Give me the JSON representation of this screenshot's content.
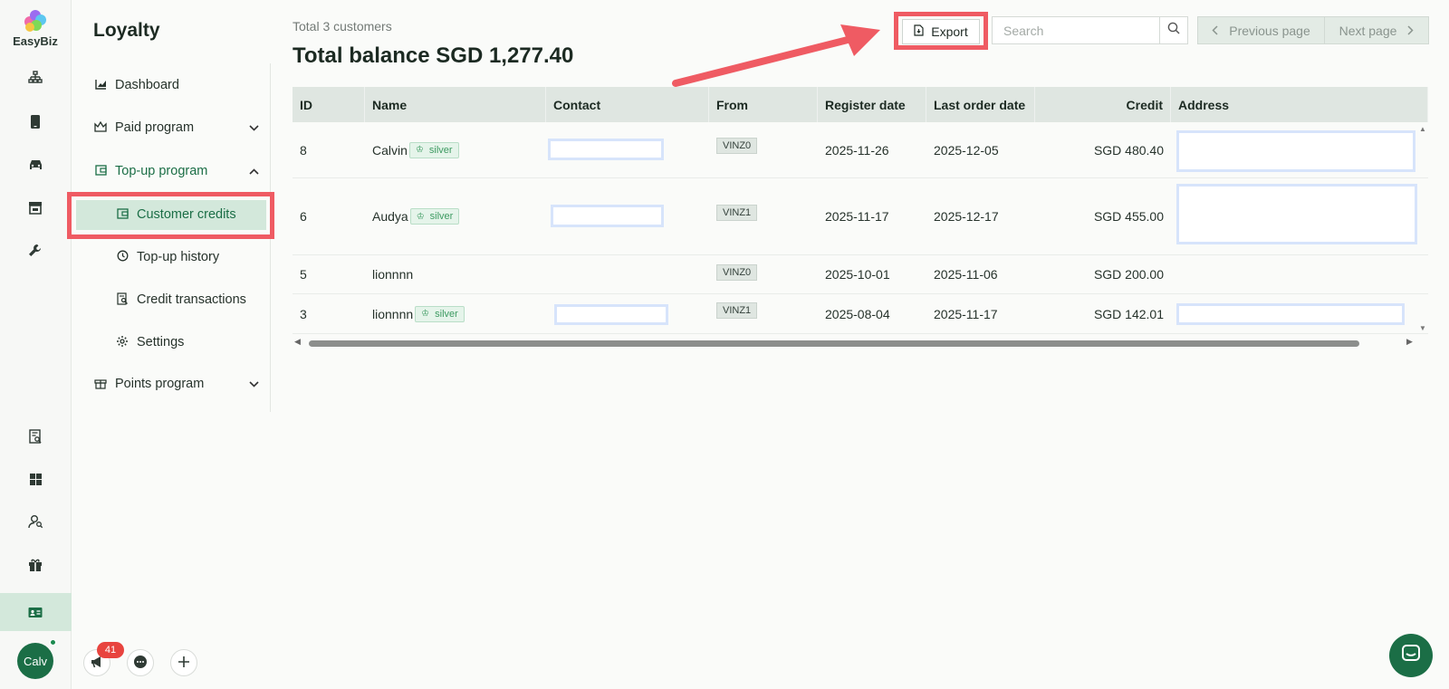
{
  "app": {
    "logo_text": "EasyBiz"
  },
  "rail": {
    "icons": [
      "sitemap-icon",
      "phone-icon",
      "car-icon",
      "store-icon",
      "wrench-icon",
      "report-icon",
      "grid-icon",
      "users-search-icon",
      "gift-icon",
      "id-card-icon"
    ],
    "active": "id-card-icon",
    "avatar_label": "Calv"
  },
  "sidebar": {
    "title": "Loyalty",
    "items": [
      {
        "label": "Dashboard",
        "icon": "chart-icon"
      },
      {
        "label": "Paid program",
        "icon": "crown-icon"
      },
      {
        "label": "Top-up program",
        "icon": "wallet-icon"
      },
      {
        "label": "Customer credits",
        "icon": "wallet-icon"
      },
      {
        "label": "Top-up history",
        "icon": "history-icon"
      },
      {
        "label": "Credit transactions",
        "icon": "receipt-search-icon"
      },
      {
        "label": "Settings",
        "icon": "gear-icon"
      },
      {
        "label": "Points program",
        "icon": "gift-icon"
      }
    ],
    "selected": "Customer credits"
  },
  "header": {
    "total_customers": "Total 3 customers",
    "total_balance": "Total balance SGD 1,277.40",
    "export_label": "Export",
    "search_placeholder": "Search",
    "prev_label": "Previous page",
    "next_label": "Next page"
  },
  "table": {
    "columns": [
      "ID",
      "Name",
      "Contact",
      "From",
      "Register date",
      "Last order date",
      "Credit",
      "Address"
    ],
    "rows": [
      {
        "id": "8",
        "name": "Calvin",
        "tier": "silver",
        "from": "VINZ0",
        "register": "2025-11-26",
        "last_order": "2025-12-05",
        "credit": "SGD 480.40"
      },
      {
        "id": "6",
        "name": "Audya",
        "tier": "silver",
        "from": "VINZ1",
        "register": "2025-11-17",
        "last_order": "2025-12-17",
        "credit": "SGD 455.00"
      },
      {
        "id": "5",
        "name": "lionnnn",
        "tier": "",
        "from": "VINZ0",
        "register": "2025-10-01",
        "last_order": "2025-11-06",
        "credit": "SGD 200.00"
      },
      {
        "id": "3",
        "name": "lionnnn",
        "tier": "silver",
        "from": "VINZ1",
        "register": "2025-08-04",
        "last_order": "2025-11-17",
        "credit": "SGD 142.01"
      }
    ]
  },
  "bottom": {
    "notification_count": "41"
  },
  "colors": {
    "brand": "#1b6e46",
    "highlight": "#ef5b63",
    "selected_bg": "#d3e8db"
  }
}
